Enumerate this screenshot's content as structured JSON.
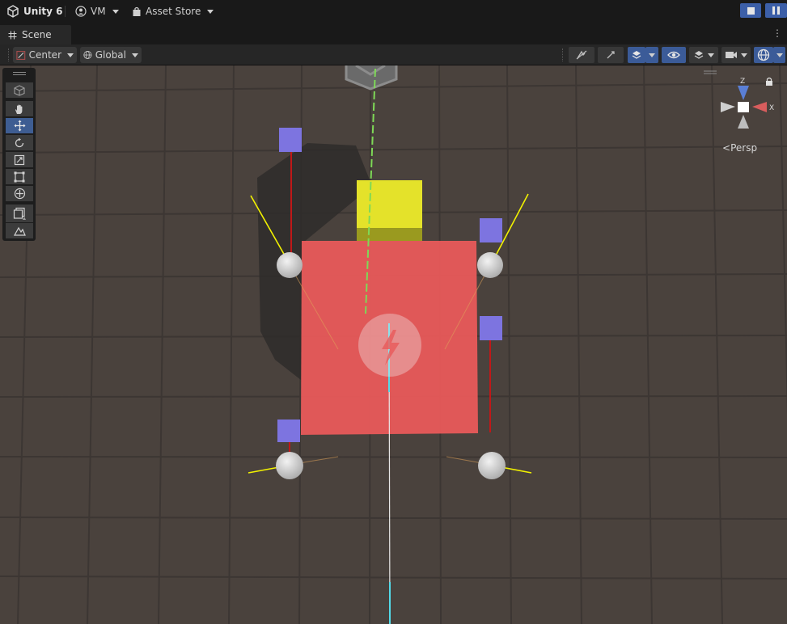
{
  "topbar": {
    "app_title": "Unity 6",
    "account_label": "VM",
    "asset_store_label": "Asset Store",
    "icons": [
      "unity-logo-icon",
      "account-icon",
      "chevron-down-icon",
      "bag-icon",
      "chevron-down-icon",
      "stop-icon",
      "pause-icon"
    ]
  },
  "tabs": [
    {
      "label": "Scene",
      "icon": "scene-grid-icon",
      "active": true
    }
  ],
  "scene_toolbar": {
    "pivot_label": "Center",
    "space_label": "Global",
    "icons": [
      "fx-toggle-icon",
      "camera-orbit-icon",
      "layers-snap-icon",
      "visibility-eye-icon",
      "layers-icon",
      "camera-icon",
      "gizmos-sphere-icon"
    ]
  },
  "tools": [
    {
      "name": "view-tool",
      "icon": "cube-icon"
    },
    {
      "name": "hand-tool",
      "icon": "hand-icon"
    },
    {
      "name": "move-tool",
      "icon": "move-arrows-icon",
      "active": true
    },
    {
      "name": "rotate-tool",
      "icon": "rotate-icon"
    },
    {
      "name": "scale-tool",
      "icon": "scale-icon"
    },
    {
      "name": "rect-tool",
      "icon": "rect-icon"
    },
    {
      "name": "transform-tool",
      "icon": "transform-icon"
    },
    {
      "name": "custom-tool",
      "icon": "square-icon"
    },
    {
      "name": "terrain-tool",
      "icon": "terrain-icon"
    }
  ],
  "gizmo": {
    "axis_z": "Z",
    "axis_x": "X",
    "projection_label": "Persp",
    "colors": {
      "x": "#d85d5d",
      "y": "#9dc25a",
      "z": "#5a7fd6"
    }
  },
  "scene": {
    "colors": {
      "ground": "#4a423d",
      "grid_line": "#3b3532",
      "red_cube": "#e85a5a",
      "yellow_cube": "#e4e22a",
      "gizmo_handle": "#7d74e0",
      "light_sphere": "#d9d9d9",
      "y_axis": "#7ed957",
      "z_axis": "#53d9e8"
    }
  }
}
